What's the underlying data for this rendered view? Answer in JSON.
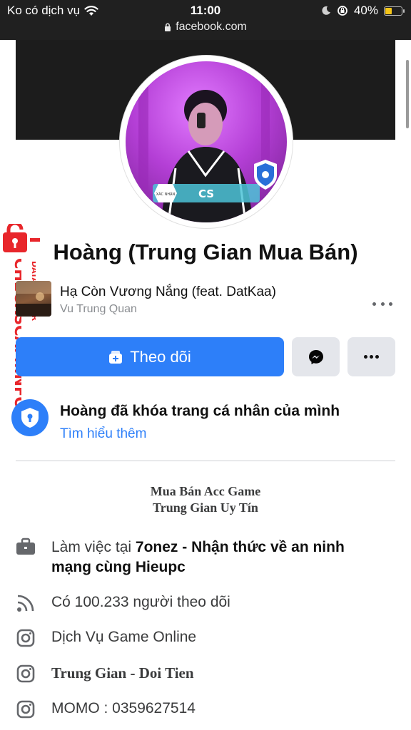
{
  "status_bar": {
    "carrier": "Ko có dịch vụ",
    "time": "11:00",
    "battery": "40%",
    "battery_level": 0.4,
    "url": "facebook.com"
  },
  "watermark": {
    "main": "CHECKSCAM.INFO",
    "sub": "DATA CENTER"
  },
  "profile": {
    "name": "Hoàng (Trung Gian Mua Bán)",
    "avatar_badge": "CS"
  },
  "music": {
    "title": "Hạ Còn Vương Nắng (feat. DatKaa)",
    "artist": "Vu Trung Quan"
  },
  "actions": {
    "follow_label": "Theo dõi"
  },
  "lock_notice": {
    "title": "Hoàng đã khóa trang cá nhân của mình",
    "link": "Tìm hiểu thêm"
  },
  "bio": {
    "line1": "Mua Bán Acc Game",
    "line2": "Trung Gian Uy Tín"
  },
  "details": {
    "work_prefix": "Làm việc tại ",
    "work_place": "7onez - Nhận thức về an ninh mạng cùng Hieupc",
    "followers": "Có 100.233 người theo dõi",
    "instagram1": "Dịch Vụ Game Online",
    "instagram2": "Trung Gian - Doi Tien",
    "instagram3": "MOMO : 0359627514"
  },
  "colors": {
    "accent": "#2d7ff9",
    "watermark": "#e8262b"
  }
}
